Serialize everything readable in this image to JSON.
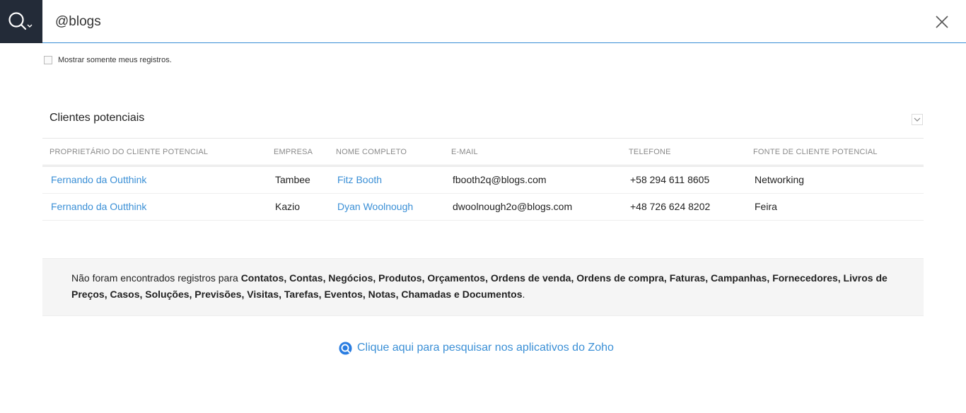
{
  "search": {
    "query": "@blogs",
    "placeholder": ""
  },
  "filter": {
    "only_mine_label": "Mostrar somente meus registros.",
    "checked": false
  },
  "leads": {
    "title": "Clientes potenciais",
    "columns": [
      "PROPRIETÁRIO DO CLIENTE POTENCIAL",
      "EMPRESA",
      "NOME COMPLETO",
      "E-MAIL",
      "TELEFONE",
      "FONTE DE CLIENTE POTENCIAL"
    ],
    "rows": [
      {
        "owner": "Fernando da Outthink",
        "company": "Tambee",
        "name": "Fitz Booth",
        "email": "fbooth2q@blogs.com",
        "phone": "+58 294 611 8605",
        "source": "Networking"
      },
      {
        "owner": "Fernando da Outthink",
        "company": "Kazio",
        "name": "Dyan Woolnough",
        "email": "dwoolnough2o@blogs.com",
        "phone": "+48 726 624 8202",
        "source": "Feira"
      }
    ]
  },
  "not_found": {
    "prefix": "Não foram encontrados registros para ",
    "modules": "Contatos, Contas, Negócios, Produtos, Orçamentos, Ordens de venda, Ordens de compra, Faturas, Campanhas, Fornecedores, Livros de Preços, Casos, Soluções, Previsões, Visitas, Tarefas, Eventos, Notas, Chamadas e Documentos",
    "suffix": "."
  },
  "zoho_link": "Clique aqui para pesquisar nos aplicativos do Zoho",
  "colors": {
    "accent": "#3a8fd6",
    "dark": "#232b38",
    "panel": "#f5f5f5"
  },
  "icons": {
    "search": "search-icon",
    "dropdown": "chevron-down-icon",
    "close": "close-icon",
    "collapse": "chevron-down-icon",
    "zoho": "zoho-search-icon"
  }
}
